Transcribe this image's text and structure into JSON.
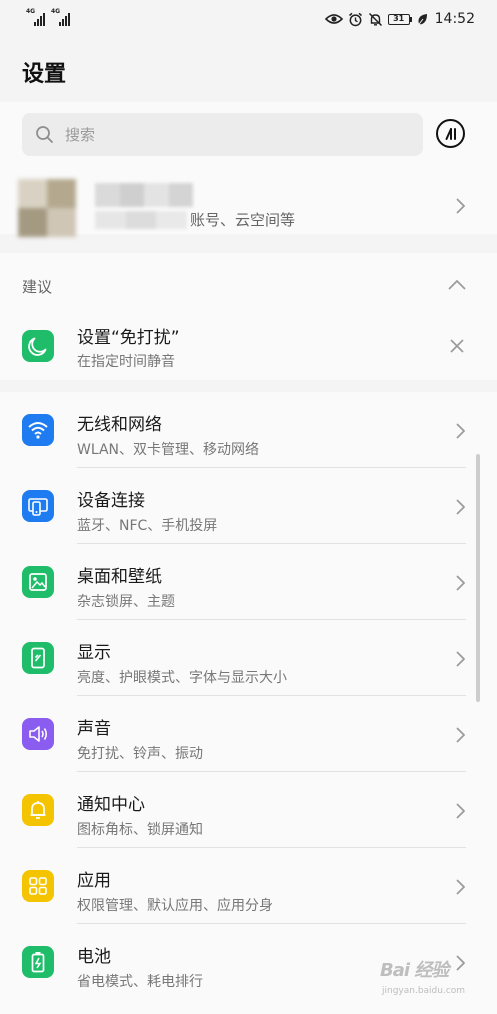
{
  "status_bar": {
    "sim1_tag": "4G",
    "sim2_tag": "4G",
    "battery_level": "31",
    "time": "14:52"
  },
  "page": {
    "title": "设置"
  },
  "search": {
    "placeholder": "搜索"
  },
  "account": {
    "subtitle": "账号、云空间等"
  },
  "suggestions": {
    "label": "建议",
    "item": {
      "title": "设置“免打扰”",
      "subtitle": "在指定时间静音"
    }
  },
  "settings": {
    "items": [
      {
        "title": "无线和网络",
        "subtitle": "WLAN、双卡管理、移动网络",
        "icon": "wifi-icon",
        "color": "#1f7cf0"
      },
      {
        "title": "设备连接",
        "subtitle": "蓝牙、NFC、手机投屏",
        "icon": "device-connection-icon",
        "color": "#1f7cf0"
      },
      {
        "title": "桌面和壁纸",
        "subtitle": "杂志锁屏、主题",
        "icon": "wallpaper-icon",
        "color": "#1fbd6a"
      },
      {
        "title": "显示",
        "subtitle": "亮度、护眼模式、字体与显示大小",
        "icon": "display-icon",
        "color": "#1fbd6a"
      },
      {
        "title": "声音",
        "subtitle": "免打扰、铃声、振动",
        "icon": "speaker-icon",
        "color": "#8a5cf0"
      },
      {
        "title": "通知中心",
        "subtitle": "图标角标、锁屏通知",
        "icon": "bell-icon",
        "color": "#f5c400"
      },
      {
        "title": "应用",
        "subtitle": "权限管理、默认应用、应用分身",
        "icon": "apps-grid-icon",
        "color": "#f5c400"
      },
      {
        "title": "电池",
        "subtitle": "省电模式、耗电排行",
        "icon": "battery-icon",
        "color": "#1fbd6a"
      }
    ]
  },
  "watermark": {
    "logo": "Bai 经验",
    "url": "jingyan.baidu.com"
  }
}
